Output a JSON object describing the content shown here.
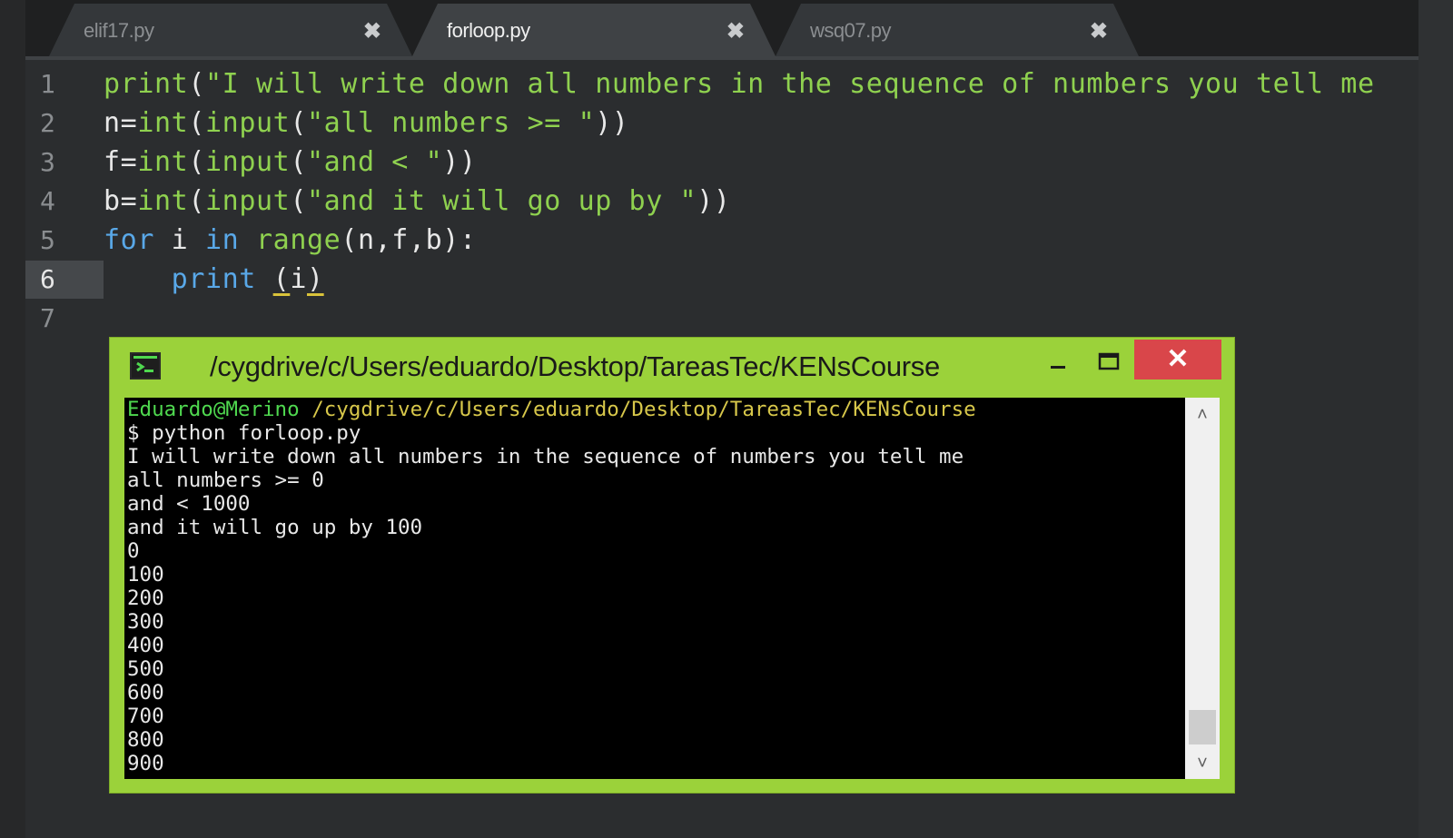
{
  "tabs": [
    {
      "label": "elif17.py",
      "close": "✖"
    },
    {
      "label": "forloop.py",
      "close": "✖"
    },
    {
      "label": "wsq07.py",
      "close": "✖"
    }
  ],
  "editor": {
    "line_numbers": [
      "1",
      "2",
      "3",
      "4",
      "5",
      "6",
      "7"
    ],
    "active_line": "6",
    "lines": [
      [
        {
          "t": "fn",
          "v": "print"
        },
        {
          "t": "pl",
          "v": "("
        },
        {
          "t": "str",
          "v": "\"I will write down all numbers in the sequence of numbers you tell me"
        }
      ],
      [
        {
          "t": "pl",
          "v": "n="
        },
        {
          "t": "fn",
          "v": "int"
        },
        {
          "t": "pl",
          "v": "("
        },
        {
          "t": "fn",
          "v": "input"
        },
        {
          "t": "pl",
          "v": "("
        },
        {
          "t": "str",
          "v": "\"all numbers >= \""
        },
        {
          "t": "pl",
          "v": "))"
        }
      ],
      [
        {
          "t": "pl",
          "v": "f="
        },
        {
          "t": "fn",
          "v": "int"
        },
        {
          "t": "pl",
          "v": "("
        },
        {
          "t": "fn",
          "v": "input"
        },
        {
          "t": "pl",
          "v": "("
        },
        {
          "t": "str",
          "v": "\"and < \""
        },
        {
          "t": "pl",
          "v": "))"
        }
      ],
      [
        {
          "t": "pl",
          "v": "b="
        },
        {
          "t": "fn",
          "v": "int"
        },
        {
          "t": "pl",
          "v": "("
        },
        {
          "t": "fn",
          "v": "input"
        },
        {
          "t": "pl",
          "v": "("
        },
        {
          "t": "str",
          "v": "\"and it will go up by \""
        },
        {
          "t": "pl",
          "v": "))"
        }
      ],
      [
        {
          "t": "kw",
          "v": "for"
        },
        {
          "t": "pl",
          "v": " i "
        },
        {
          "t": "kw",
          "v": "in"
        },
        {
          "t": "pl",
          "v": " "
        },
        {
          "t": "fn",
          "v": "range"
        },
        {
          "t": "pl",
          "v": "(n,f,b):"
        }
      ],
      [
        {
          "t": "pl",
          "v": "    "
        },
        {
          "t": "kw",
          "v": "print"
        },
        {
          "t": "pl",
          "v": " "
        },
        {
          "t": "cu",
          "v": "("
        },
        {
          "t": "pl",
          "v": "i"
        },
        {
          "t": "cu",
          "v": ")"
        }
      ],
      []
    ]
  },
  "terminal": {
    "title": "/cygdrive/c/Users/eduardo/Desktop/TareasTec/KENsCourse",
    "minimize": "—",
    "maximize": "☐",
    "close": "✕",
    "prompt_user": "Eduardo@Merino",
    "prompt_path": " /cygdrive/c/Users/eduardo/Desktop/TareasTec/KENsCourse",
    "output": [
      "$ python forloop.py",
      "I will write down all numbers in the sequence of numbers you tell me",
      "all numbers >= 0",
      "and < 1000",
      "and it will go up by 100",
      "0",
      "100",
      "200",
      "300",
      "400",
      "500",
      "600",
      "700",
      "800",
      "900"
    ],
    "scroll_up": "˄",
    "scroll_down": "˅"
  },
  "colors": {
    "terminal_border": "#9bd23a",
    "close_button": "#d9464a",
    "string": "#8fd14f",
    "keyword": "#59a8e8"
  }
}
